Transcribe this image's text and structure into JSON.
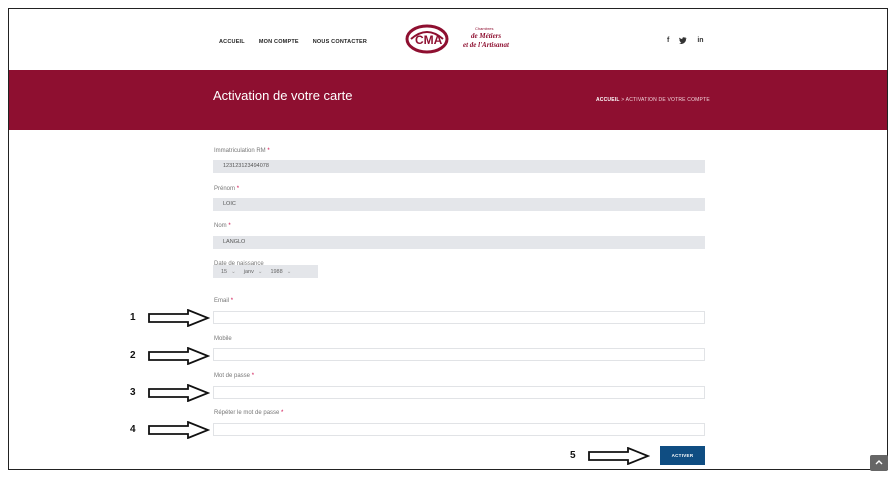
{
  "nav": {
    "items": [
      "ACCUEIL",
      "MON COMPTE",
      "NOUS CONTACTER"
    ]
  },
  "logo": {
    "mark": "CMA",
    "line1": "Chambres",
    "line2": "de Métiers",
    "line3": "et de l'Artisanat"
  },
  "social": [
    "f",
    "y",
    "in"
  ],
  "banner": {
    "title": "Activation de votre carte",
    "breadcrumb_home": "ACCUEIL",
    "breadcrumb_sep": ">",
    "breadcrumb_current": "ACTIVATION DE VOTRE COMPTE"
  },
  "form": {
    "immatriculation": {
      "label": "Immatriculation RM",
      "value": "123123123494078"
    },
    "prenom": {
      "label": "Prénom",
      "value": "LOIC"
    },
    "nom": {
      "label": "Nom",
      "value": "LANGLO"
    },
    "naissance": {
      "label": "Date de naissance",
      "day": "15",
      "month": "janv",
      "year": "1988"
    },
    "email": {
      "label": "Email",
      "value": ""
    },
    "mobile": {
      "label": "Mobile",
      "value": ""
    },
    "password": {
      "label": "Mot de passe",
      "value": ""
    },
    "password_confirm": {
      "label": "Répéter le mot de passe",
      "value": ""
    },
    "required_mark": "*",
    "submit": "ACTIVER"
  },
  "annotations": [
    "1",
    "2",
    "3",
    "4",
    "5"
  ],
  "colors": {
    "brand": "#8e0f30",
    "button": "#0f4d82"
  }
}
